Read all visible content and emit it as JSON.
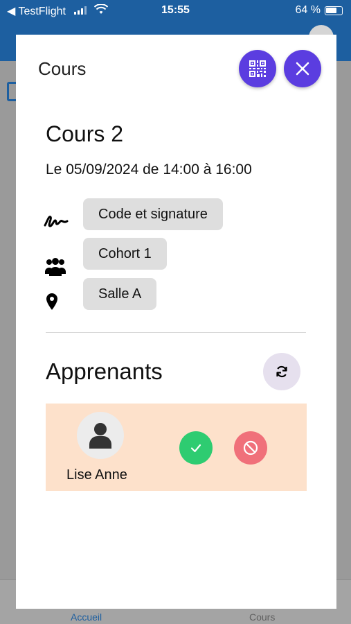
{
  "status_bar": {
    "back_app": "◀ TestFlight",
    "time": "15:55",
    "battery": "64 %"
  },
  "tabbar": {
    "home_label": "Accueil",
    "courses_label": "Cours"
  },
  "modal": {
    "title": "Cours",
    "course": {
      "name": "Cours 2",
      "date_line": "Le 05/09/2024 de 14:00 à 16:00",
      "signature_mode": "Code et signature",
      "cohort": "Cohort 1",
      "room": "Salle A"
    },
    "learners_section": {
      "title": "Apprenants",
      "learners": [
        {
          "name": "Lise Anne",
          "status_color": "#fde1cb"
        }
      ]
    }
  },
  "colors": {
    "accent": "#5b3de0",
    "header_blue": "#1d5fa0",
    "present_green": "#2ecc71",
    "absent_red": "#f0707a"
  },
  "icons": {
    "qr": "qr-code-icon",
    "close": "close-icon",
    "signature": "signature-icon",
    "group": "users-icon",
    "location": "location-pin-icon",
    "refresh": "refresh-icon",
    "user": "user-icon",
    "check": "check-icon",
    "ban": "ban-icon"
  }
}
